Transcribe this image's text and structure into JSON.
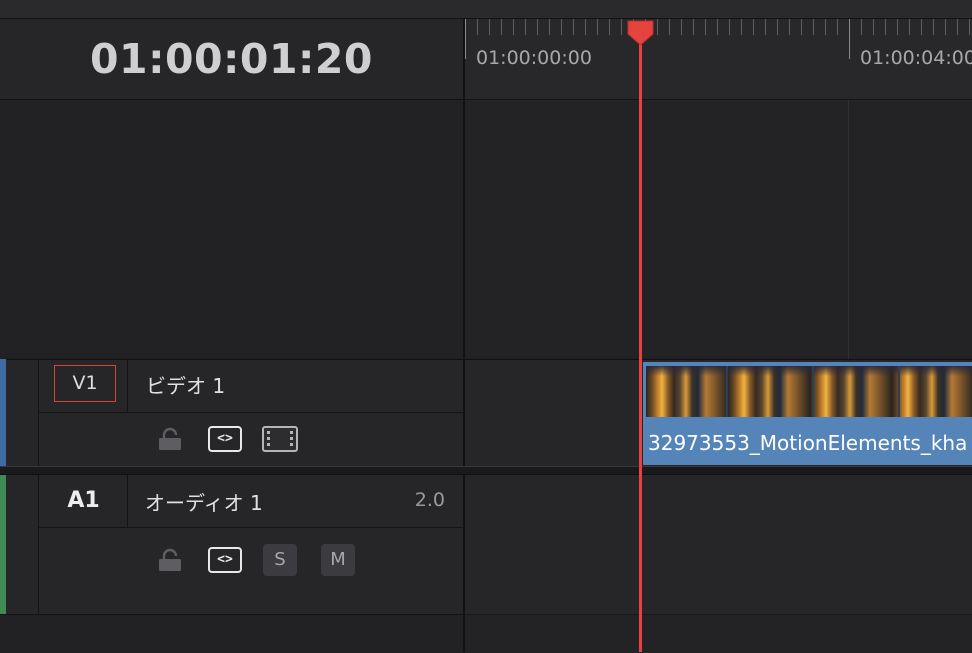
{
  "timecode": "01:00:01:20",
  "ruler": {
    "labels": [
      "01:00:00:00",
      "01:00:04:00"
    ]
  },
  "tracks": {
    "video": {
      "id_label": "V1",
      "name": "ビデオ 1",
      "toggle_label": "<>",
      "color": "#3e6ca2"
    },
    "audio": {
      "id_label": "A1",
      "name": "オーディオ 1",
      "channels": "2.0",
      "toggle_label": "<>",
      "solo_label": "S",
      "mute_label": "M",
      "color": "#3f8a57"
    }
  },
  "clip": {
    "label": "32973553_MotionElements_kha",
    "color": "#5584b8"
  },
  "playhead_color": "#e4433e",
  "icons": {
    "lock": "lock-icon",
    "auto_select": "auto-select-toggle-icon",
    "video_enable": "film-strip-icon"
  }
}
